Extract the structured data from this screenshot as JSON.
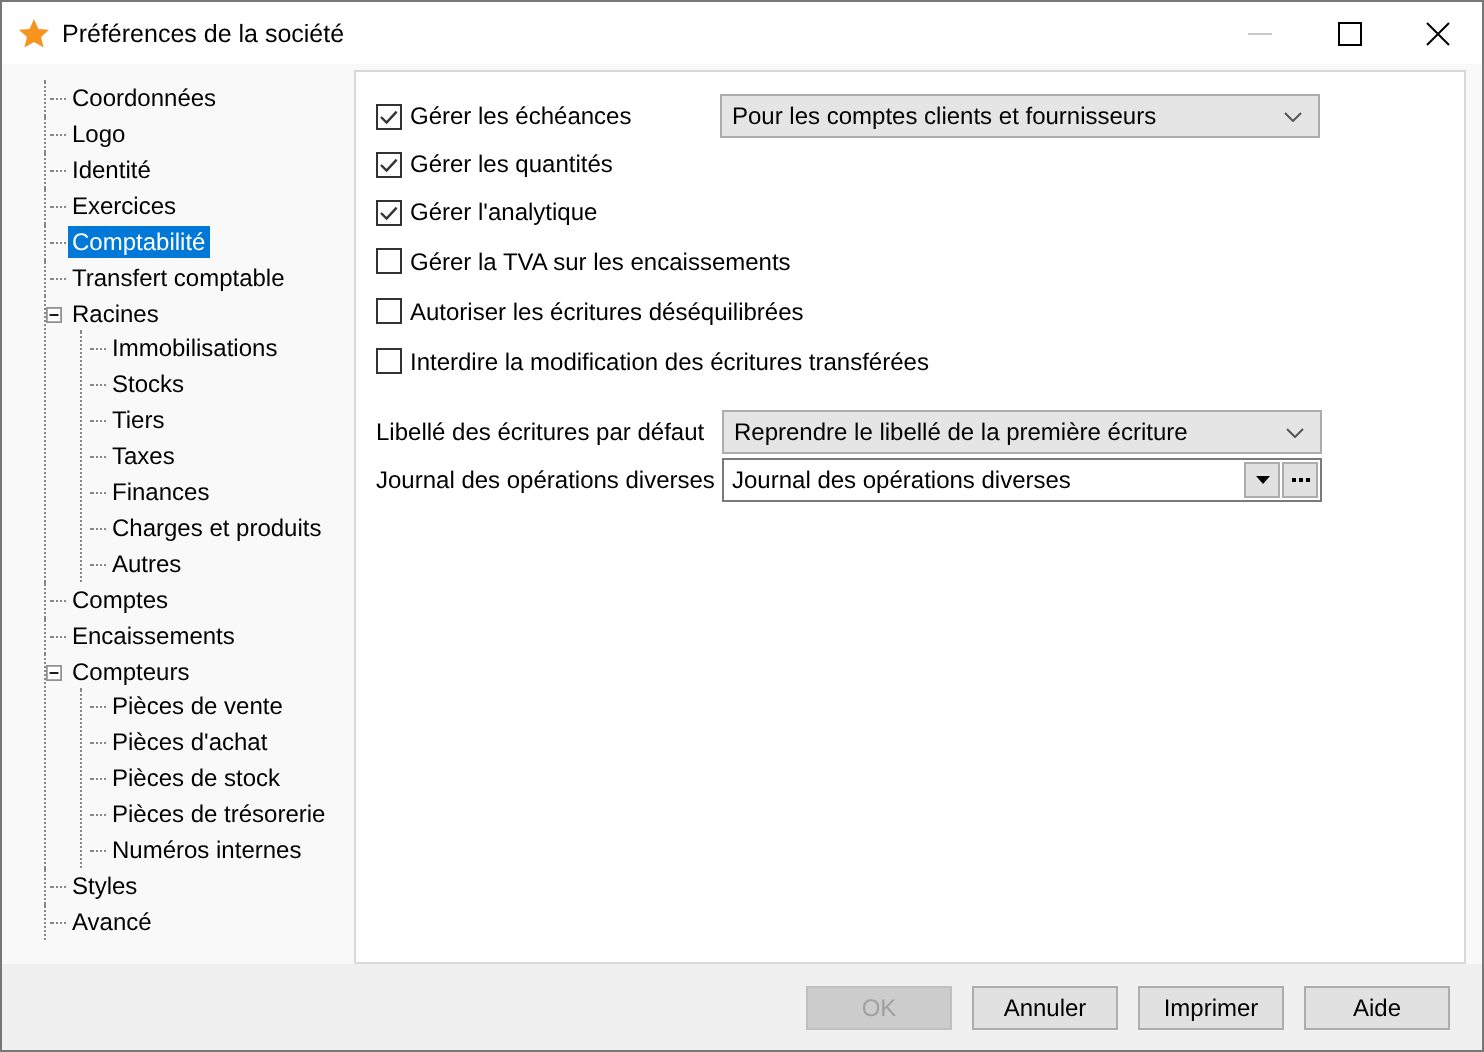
{
  "window": {
    "title": "Préférences de la société",
    "minimize_disabled": true
  },
  "tree": [
    {
      "label": "Coordonnées",
      "selected": false
    },
    {
      "label": "Logo",
      "selected": false
    },
    {
      "label": "Identité",
      "selected": false
    },
    {
      "label": "Exercices",
      "selected": false
    },
    {
      "label": "Comptabilité",
      "selected": true
    },
    {
      "label": "Transfert comptable",
      "selected": false
    },
    {
      "label": "Racines",
      "selected": false,
      "expanded": true,
      "children": [
        {
          "label": "Immobilisations",
          "selected": false
        },
        {
          "label": "Stocks",
          "selected": false
        },
        {
          "label": "Tiers",
          "selected": false
        },
        {
          "label": "Taxes",
          "selected": false
        },
        {
          "label": "Finances",
          "selected": false
        },
        {
          "label": "Charges et produits",
          "selected": false
        },
        {
          "label": "Autres",
          "selected": false
        }
      ]
    },
    {
      "label": "Comptes",
      "selected": false
    },
    {
      "label": "Encaissements",
      "selected": false
    },
    {
      "label": "Compteurs",
      "selected": false,
      "expanded": true,
      "children": [
        {
          "label": "Pièces de vente",
          "selected": false
        },
        {
          "label": "Pièces d'achat",
          "selected": false
        },
        {
          "label": "Pièces de stock",
          "selected": false
        },
        {
          "label": "Pièces de trésorerie",
          "selected": false
        },
        {
          "label": "Numéros internes",
          "selected": false
        }
      ]
    },
    {
      "label": "Styles",
      "selected": false
    },
    {
      "label": "Avancé",
      "selected": false
    }
  ],
  "options": [
    {
      "label": "Gérer les échéances",
      "checked": true,
      "dropdown": "Pour les comptes clients et fournisseurs"
    },
    {
      "label": "Gérer les quantités",
      "checked": true
    },
    {
      "label": "Gérer l'analytique",
      "checked": true
    },
    {
      "label": "Gérer la TVA sur les encaissements",
      "checked": false
    },
    {
      "label": "Autoriser les écritures déséquilibrées",
      "checked": false
    },
    {
      "label": "Interdire la modification des écritures transférées",
      "checked": false
    }
  ],
  "fields": [
    {
      "kind": "dropdown",
      "label": "Libellé des écritures par défaut",
      "value": "Reprendre le libellé de la première écriture"
    },
    {
      "kind": "combo",
      "label": "Journal des opérations diverses",
      "value": "Journal des opérations diverses"
    }
  ],
  "buttons": [
    {
      "label": "OK",
      "disabled": true
    },
    {
      "label": "Annuler",
      "disabled": false
    },
    {
      "label": "Imprimer",
      "disabled": false
    },
    {
      "label": "Aide",
      "disabled": false
    }
  ]
}
